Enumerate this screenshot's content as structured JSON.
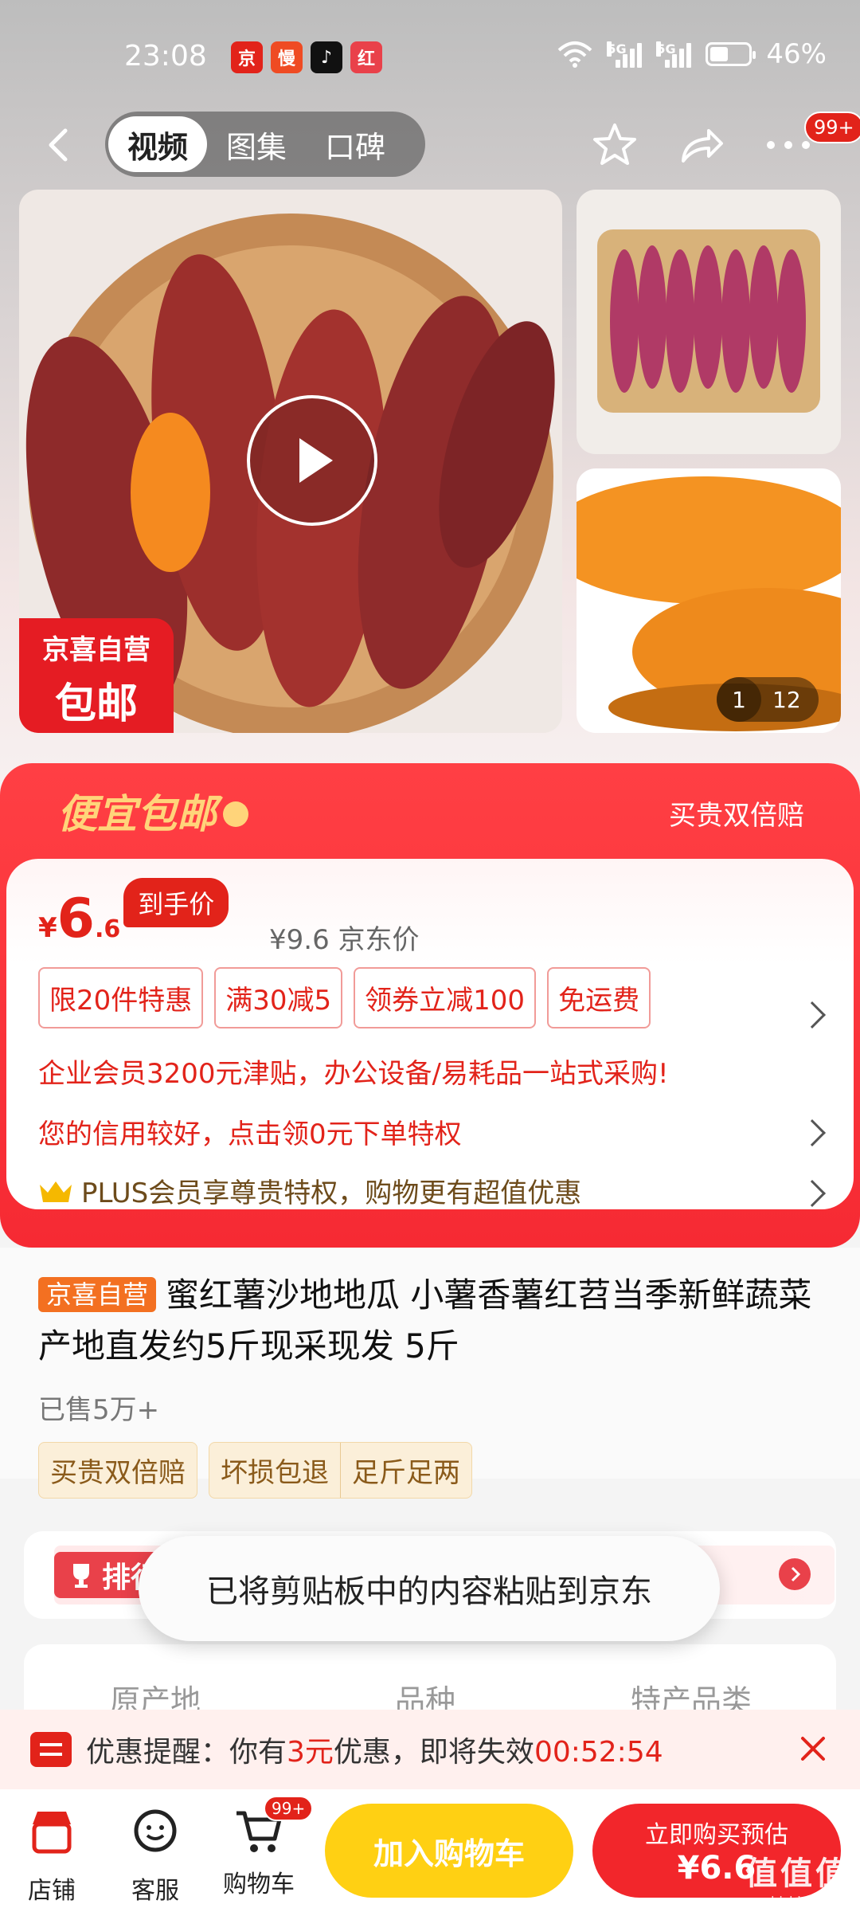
{
  "status_bar": {
    "time": "23:08",
    "notif_icons": [
      {
        "name": "jd-app-icon",
        "color": "#e2231a",
        "glyph": "京"
      },
      {
        "name": "man-app-icon",
        "color": "#ef4b23",
        "glyph": "慢"
      },
      {
        "name": "tiktok-icon",
        "color": "#111111",
        "glyph": "♪"
      },
      {
        "name": "red-envelope-app-icon",
        "color": "#e9414a",
        "glyph": "红"
      }
    ],
    "network_1": "5G",
    "network_2": "5G",
    "battery": "46%",
    "battery_level": 0.46
  },
  "nav": {
    "tabs": [
      "视频",
      "图集",
      "口碑"
    ],
    "active_tab": 0,
    "more_badge": "99+"
  },
  "gallery": {
    "promo_tag_line1": "京喜自营",
    "promo_tag_line2": "包邮",
    "page_current": "1",
    "page_total": "12"
  },
  "promo": {
    "title": "便宜包邮",
    "right_text": "买贵双倍赔",
    "price_symbol": "¥",
    "price_int": "6",
    "price_dec": ".6",
    "price_tag": "到手价",
    "ref_price": "¥9.6 京东价",
    "coupons": [
      "限20件特惠",
      "满30减5",
      "领券立减100",
      "免运费"
    ],
    "line_enterprise": "企业会员3200元津贴，办公设备/易耗品一站式采购!",
    "line_credit": "您的信用较好，点击领0元下单特权",
    "line_plus": "PLUS会员享尊贵特权，购物更有超值优惠"
  },
  "product": {
    "self_tag": "京喜自营",
    "title": "蜜红薯沙地地瓜 小薯香薯红苕当季新鲜蔬菜产地直发约5斤现采现发 5斤",
    "sold": "已售5万+",
    "guarantees": [
      "买贵双倍赔",
      "坏损包退",
      "足斤足两"
    ]
  },
  "rank": {
    "tag": "排行榜"
  },
  "toast": "已将剪贴板中的内容粘贴到京东",
  "specs": {
    "labels": [
      "原产地",
      "品种",
      "特产品类"
    ]
  },
  "reminder": {
    "prefix": "优惠提醒：你有",
    "amount": "3元",
    "middle": "优惠，即将失效",
    "countdown": "00:52:54"
  },
  "bottom_bar": {
    "shop": "店铺",
    "service": "客服",
    "cart": "购物车",
    "cart_badge": "99+",
    "add_cart": "加入购物车",
    "buy_line1": "立即购买预估",
    "buy_line2": "¥6.6"
  },
  "watermark": {
    "line1": "值值值",
    "line2": "zhizhizhi.com"
  },
  "colors": {
    "jd_red": "#e2231a",
    "gold": "#ffd47a",
    "add_cart_yellow": "#ffd013"
  }
}
